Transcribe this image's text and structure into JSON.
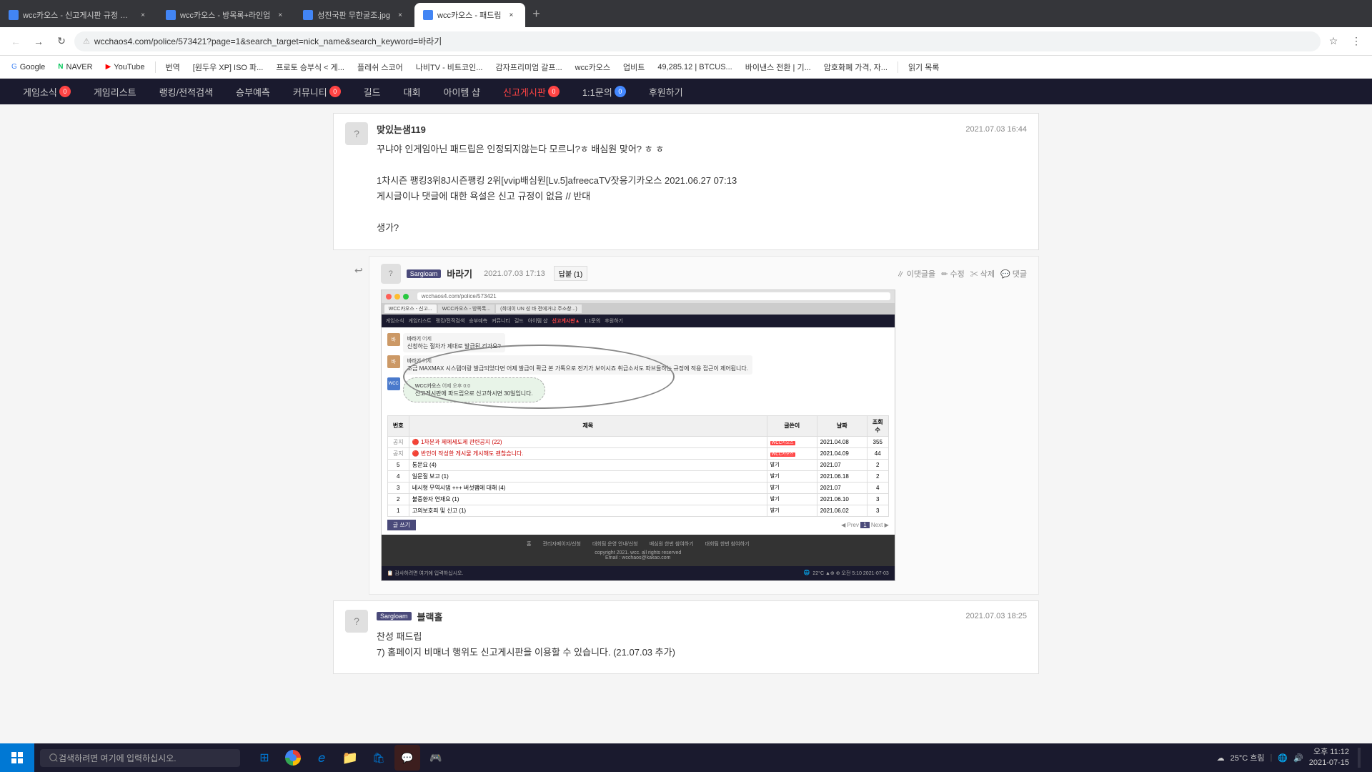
{
  "browser": {
    "tabs": [
      {
        "id": 1,
        "title": "wcc카오스 - 신고게시판 규정 변...",
        "active": false,
        "color": "#4285f4"
      },
      {
        "id": 2,
        "title": "wcc카오스 - 방목록+라인업",
        "active": false,
        "color": "#4285f4"
      },
      {
        "id": 3,
        "title": "성진국판 무한굴조.jpg",
        "active": false,
        "color": "#4285f4"
      },
      {
        "id": 4,
        "title": "wcc카오스 - 패드립",
        "active": true,
        "color": "#4285f4"
      }
    ],
    "address": "wcchaos4.com/police/573421?page=1&search_target=nick_name&search_keyword=바라기",
    "bookmarks": [
      {
        "label": "Google"
      },
      {
        "label": "NAVER"
      },
      {
        "label": "YouTube"
      },
      {
        "label": "번역"
      },
      {
        "label": "[원두우 XP] ISO 파..."
      },
      {
        "label": "프로토 승부식 < 게..."
      },
      {
        "label": "플레쉬 스코어"
      },
      {
        "label": "나비TV - 비트코인..."
      },
      {
        "label": "감자프리미엄 갈프..."
      },
      {
        "label": "wcc카오스"
      },
      {
        "label": "업비트"
      },
      {
        "label": "49,285.12 | BTCUS..."
      },
      {
        "label": "바이낸스 전환 | 기..."
      },
      {
        "label": "암호화폐 가격, 자..."
      },
      {
        "label": "읽기 목록"
      }
    ]
  },
  "site_nav": {
    "items": [
      {
        "label": "게임소식",
        "badge": "0",
        "badge_color": "red"
      },
      {
        "label": "게임리스트"
      },
      {
        "label": "랭킹/전적검색"
      },
      {
        "label": "승부예측"
      },
      {
        "label": "커뮤니티",
        "badge": "0",
        "badge_color": "red"
      },
      {
        "label": "길드"
      },
      {
        "label": "대회"
      },
      {
        "label": "아이템 샵"
      },
      {
        "label": "신고게시판",
        "badge": "0",
        "badge_color": "red",
        "active": true
      },
      {
        "label": "1:1문의",
        "badge": "0",
        "badge_color": "blue"
      },
      {
        "label": "후원하기"
      }
    ]
  },
  "comments": [
    {
      "id": "comment1",
      "avatar": "?",
      "name": "맞있는샘119",
      "badge": null,
      "date": "2021.07.03 16:44",
      "text_lines": [
        "꾸냐야 인게임아닌 패드립은 인정되지않는다 모르니?ㅎ 배심원 맞어? ㅎ ㅎ",
        "",
        "1차시즌 팽킹3위8J시즌팽킹 2위[vvip배심원[Lv.5]afreecaTV잣응기카오스 2021.06.27 07:13",
        "게시글이나 댓글에 대한 욕설은 신고 규정이 없음 // 반대",
        "",
        "생가?"
      ]
    }
  ],
  "reply": {
    "id": "reply1",
    "avatar": "?",
    "name": "바라기",
    "badge_text": "Sargloam",
    "date": "2021.07.03 17:13",
    "reply_count": 1,
    "actions": [
      "이댓글을",
      "수정",
      "삭제",
      "댓글"
    ],
    "screenshot_description": "wcchaos4.com 신고게시판 화면 캡처"
  },
  "screenshot": {
    "url": "wcchaos4.com/police/573421",
    "chat_messages": [
      {
        "name": "바라기",
        "time": "어제",
        "text": "신청하는 절차가 제대로 발급된 건가요?"
      },
      {
        "name": "바라기",
        "time": "어제",
        "text": "조금 MAXMAX 시스템이랑 발급되었다면 어제 발급이 확금 본 가톡으로 전기가 보이시죠 취급소서도 파브들하는 규정에 적용 접근이 제어됩니다."
      },
      {
        "name": "WCC카오스",
        "time": "어제 오후 0:0",
        "text": "신고게시판에 파드립으로 신고하시면 30일입니다."
      }
    ],
    "table": {
      "headers": [
        "번호",
        "제목",
        "글쓴이",
        "날짜",
        "조회수"
      ],
      "rows": [
        {
          "num": "공지",
          "title": "1차분과 제에세도제 관련공지 (22)",
          "has_icon": true,
          "author": "WCC카오스",
          "date": "2021.04.08",
          "views": "355"
        },
        {
          "num": "공지",
          "title": "반인이 작성한 게시물 게시해도 괜찮습니다.",
          "has_icon": true,
          "author": "WCC카오스",
          "date": "2021.04.09",
          "views": "44"
        },
        {
          "num": "5",
          "title": "통문요 (4)",
          "has_icon": false,
          "author": "발기",
          "date": "2021.07",
          "views": "2"
        },
        {
          "num": "4",
          "title": "일문질 보고 (1)",
          "has_icon": false,
          "author": "발기",
          "date": "2021.06.18",
          "views": "2"
        },
        {
          "num": "3",
          "title": "네시형 무역시댐 +++ 버섯팸에 대해 (4)",
          "has_icon": false,
          "author": "발기",
          "date": "2021.07",
          "views": "4"
        },
        {
          "num": "2",
          "title": "불중환자 연재요 (1)",
          "has_icon": false,
          "author": "발기",
          "date": "2021.06.10",
          "views": "3"
        },
        {
          "num": "1",
          "title": "고의보호죄 및 신고 (1)",
          "has_icon": false,
          "author": "발기",
          "date": "2021.06.02",
          "views": "3"
        }
      ]
    }
  },
  "comment2": {
    "avatar": "?",
    "name": "블랙홀",
    "badge_text": "Sargloam",
    "date": "2021.07.03 18:25",
    "text_lines": [
      "찬성 패드립",
      "7) 홈페이지 비매너 행위도 신고게시판을 이용할 수 있습니다. (21.07.03 추가)"
    ]
  },
  "taskbar": {
    "search_placeholder": "검색하려면 여기에 입력하십시오.",
    "weather": "25°C 흐림",
    "time": "오후 11:12",
    "date": "2021-07-15"
  },
  "icons": {
    "back": "←",
    "forward": "→",
    "refresh": "↻",
    "lock": "🔒",
    "star": "☆",
    "menu": "⋮",
    "close": "×",
    "reply_arrow": "↩",
    "new_tab": "+"
  }
}
